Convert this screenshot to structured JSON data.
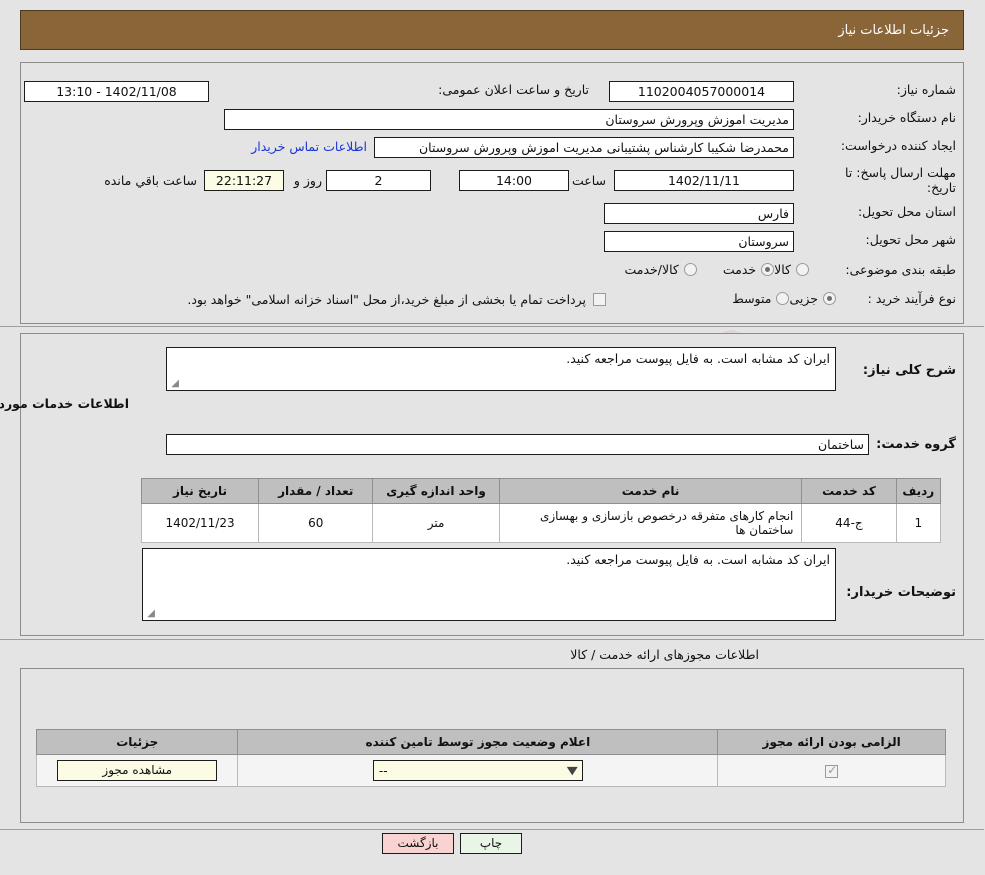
{
  "header": {
    "title": "جزئیات اطلاعات نیاز"
  },
  "watermark": {
    "text": "AnaTender.net"
  },
  "form": {
    "need_number_label": "شماره نیاز:",
    "need_number_value": "1102004057000014",
    "announce_datetime_label": "تاریخ و ساعت اعلان عمومی:",
    "announce_datetime_value": "1402/11/08 - 13:10",
    "buyer_org_label": "نام دستگاه خریدار:",
    "buyer_org_value": "مدیریت اموزش وپرورش سروستان",
    "requester_label": "ایجاد کننده درخواست:",
    "requester_value": "محمدرضا شکیبا کارشناس پشتیبانی مدیریت اموزش وپرورش سروستان",
    "contact_link": "اطلاعات تماس خریدار",
    "deadline_label_line1": "مهلت ارسال پاسخ: تا",
    "deadline_label_line2": "تاریخ:",
    "deadline_date_value": "1402/11/11",
    "hour_label": "ساعت",
    "hour_value": "14:00",
    "days_value": "2",
    "days_label": "روز و",
    "countdown_value": "22:11:27",
    "remaining_label": "ساعت باقي مانده",
    "province_label": "استان محل تحویل:",
    "province_value": "فارس",
    "city_label": "شهر محل تحویل:",
    "city_value": "سروستان",
    "category_label": "طبقه بندی موضوعی:",
    "category_options": [
      {
        "label": "کالا",
        "selected": false
      },
      {
        "label": "خدمت",
        "selected": true
      },
      {
        "label": "کالا/خدمت",
        "selected": false
      }
    ],
    "process_label": "نوع فرآیند خرید :",
    "process_options": [
      {
        "label": "جزیی",
        "selected": true
      },
      {
        "label": "متوسط",
        "selected": false
      }
    ],
    "treasury_checkbox_checked": false,
    "treasury_text": "پرداخت تمام یا بخشی از مبلغ خرید،از محل \"اسناد خزانه اسلامی\" خواهد بود."
  },
  "description": {
    "general_label": "شرح کلی نیاز:",
    "general_value": "ایران کد مشابه است. به فایل پیوست مراجعه کنید.",
    "services_section_title": "اطلاعات خدمات مورد نیاز",
    "service_group_label": "گروه خدمت:",
    "service_group_value": "ساختمان"
  },
  "services_table": {
    "columns": [
      "ردیف",
      "کد خدمت",
      "نام خدمت",
      "واحد اندازه گیری",
      "تعداد / مقدار",
      "تاریخ نیاز"
    ],
    "rows": [
      {
        "row": "1",
        "code": "ج-44",
        "name": "انجام کارهای متفرقه درخصوص بازسازی و بهسازی ساختمان ها",
        "unit": "متر",
        "quantity": "60",
        "date": "1402/11/23"
      }
    ]
  },
  "buyer_notes": {
    "label": "توضیحات خریدار:",
    "value": "ایران کد مشابه است. به فایل پیوست مراجعه کنید."
  },
  "permits": {
    "section_title": "اطلاعات مجوزهای ارائه خدمت / کالا",
    "columns": [
      "الزامی بودن ارائه مجوز",
      "اعلام وضعیت مجوز توسط تامین کننده",
      "جزئیات"
    ],
    "rows": [
      {
        "required_checked": true,
        "status_value": "--",
        "detail_button": "مشاهده مجوز"
      }
    ]
  },
  "footer": {
    "print_label": "چاپ",
    "back_label": "بازگشت"
  }
}
